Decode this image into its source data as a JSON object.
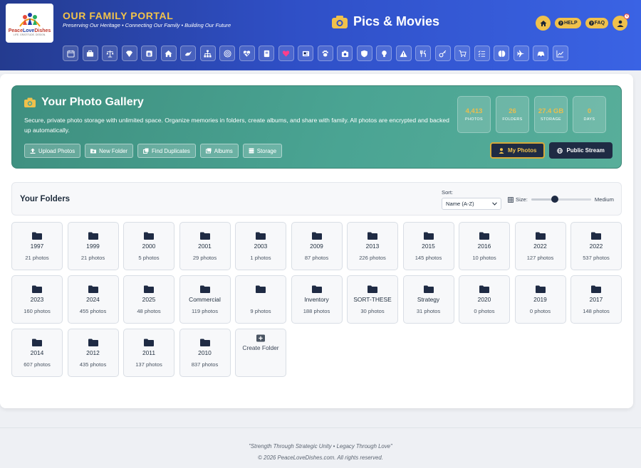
{
  "brand": {
    "logo_text_a": "Peace",
    "logo_text_b": "Love",
    "logo_text_c": "Dishes",
    "logo_sub": "LIFE. GRATITUDE. DESIGN.",
    "portal_title": "OUR FAMILY PORTAL",
    "tagline": "Preserving Our Heritage • Connecting Our Family • Building Our Future"
  },
  "page": {
    "title": "Pics & Movies"
  },
  "top_actions": {
    "help_label": "HELP",
    "faq_label": "FAQ",
    "notification_count": "4"
  },
  "nav_icons": [
    "calendar-icon",
    "briefcase-icon",
    "scale-icon",
    "gem-icon",
    "blog-icon",
    "home-icon",
    "bird-icon",
    "sitemap-icon",
    "target-icon",
    "heart-pulse-icon",
    "book-icon",
    "heart-icon",
    "newspaper-icon",
    "paw-icon",
    "camera-icon",
    "shield-icon",
    "lightbulb-icon",
    "warning-icon",
    "utensils-icon",
    "key-icon",
    "cart-icon",
    "checklist-icon",
    "brain-icon",
    "plane-icon",
    "car-icon",
    "chart-icon"
  ],
  "gallery": {
    "title": "Your Photo Gallery",
    "description": "Secure, private photo storage with unlimited space. Organize memories in folders, create albums, and share with family. All photos are encrypted and backed up automatically.",
    "actions": [
      "Upload Photos",
      "New Folder",
      "Find Duplicates",
      "Albums",
      "Storage"
    ],
    "stats": [
      {
        "value": "4,413",
        "label": "PHOTOS"
      },
      {
        "value": "26",
        "label": "FOLDERS"
      },
      {
        "value": "27.4 GB",
        "label": "STORAGE"
      },
      {
        "value": "0",
        "label": "DAYS"
      }
    ],
    "view_my_photos": "My Photos",
    "view_public_stream": "Public Stream"
  },
  "folders_toolbar": {
    "title": "Your Folders",
    "sort_label": "Sort:",
    "sort_value": "Name (A-Z)",
    "size_label": "Size:",
    "size_value": "Medium",
    "size_level": 0.4
  },
  "folders": [
    {
      "name": "1997",
      "count": "21 photos"
    },
    {
      "name": "1999",
      "count": "21 photos"
    },
    {
      "name": "2000",
      "count": "5 photos"
    },
    {
      "name": "2001",
      "count": "29 photos"
    },
    {
      "name": "2003",
      "count": "1 photos"
    },
    {
      "name": "2009",
      "count": "87 photos"
    },
    {
      "name": "2013",
      "count": "226 photos"
    },
    {
      "name": "2015",
      "count": "145 photos"
    },
    {
      "name": "2016",
      "count": "10 photos"
    },
    {
      "name": "2022",
      "count": "127 photos"
    },
    {
      "name": "2022",
      "count": "537 photos"
    },
    {
      "name": "2023",
      "count": "160 photos"
    },
    {
      "name": "2024",
      "count": "455 photos"
    },
    {
      "name": "2025",
      "count": "48 photos"
    },
    {
      "name": "Commercial",
      "count": "119 photos"
    },
    {
      "name": "",
      "count": "9 photos"
    },
    {
      "name": "Inventory",
      "count": "188 photos"
    },
    {
      "name": "SORT-THESE",
      "count": "30 photos"
    },
    {
      "name": "Strategy",
      "count": "31 photos"
    },
    {
      "name": "2020",
      "count": "0 photos"
    },
    {
      "name": "2019",
      "count": "0 photos"
    },
    {
      "name": "2017",
      "count": "148 photos"
    },
    {
      "name": "2014",
      "count": "607 photos"
    },
    {
      "name": "2012",
      "count": "435 photos"
    },
    {
      "name": "2011",
      "count": "137 photos"
    },
    {
      "name": "2010",
      "count": "837 photos"
    }
  ],
  "create_folder_label": "Create Folder",
  "footer": {
    "motto": "\"Strength Through Strategic Unity • Legacy Through Love\"",
    "copyright": "© 2026 PeaceLoveDishes.com. All rights reserved."
  },
  "colors": {
    "accent_gold": "#f0c14b",
    "header_blue": "#2f4fc6",
    "hero_green": "#4aa493",
    "dark_navy": "#1f2b44"
  }
}
